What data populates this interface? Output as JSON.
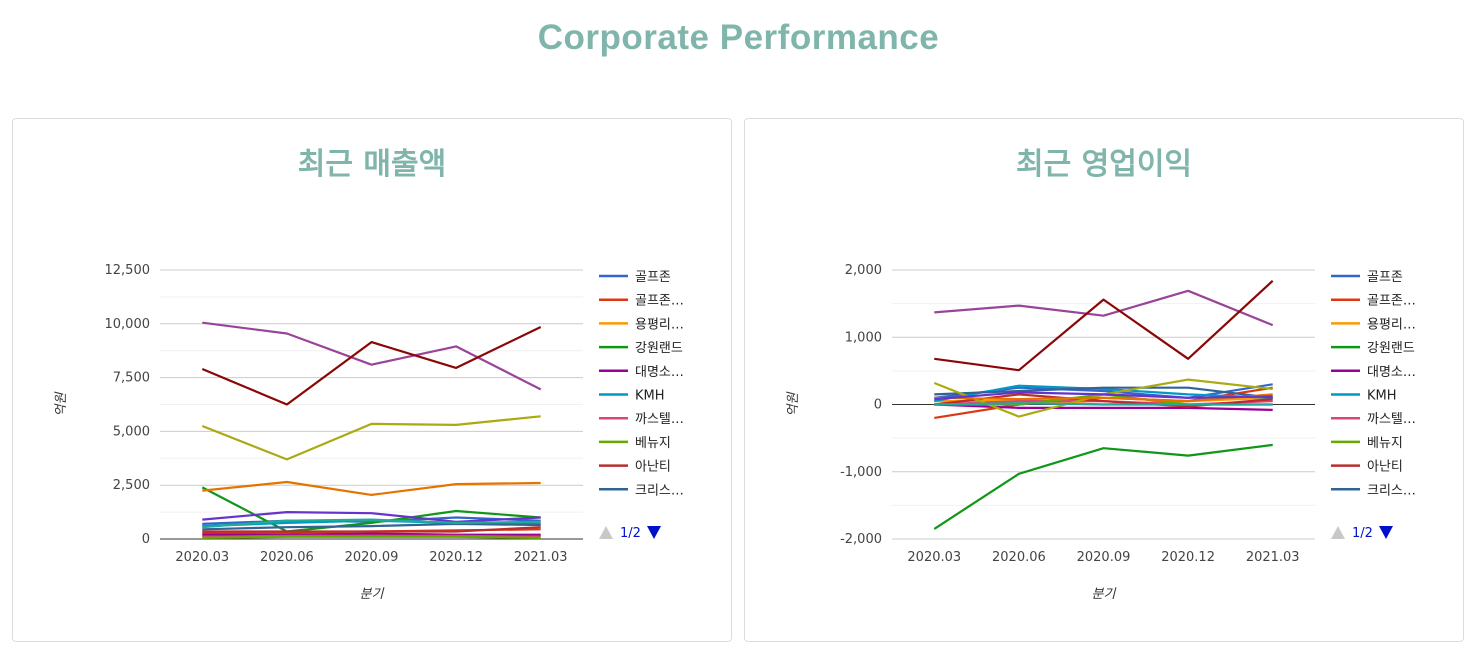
{
  "page": {
    "title": "Corporate Performance"
  },
  "colors": {
    "title": "#7fb5ab",
    "series": [
      "#3366cc",
      "#dc3912",
      "#ff9900",
      "#109618",
      "#990099",
      "#0099c6",
      "#dd4477",
      "#66aa00",
      "#b82e2e",
      "#316395"
    ],
    "extra_series": [
      "#994499",
      "#8b0707",
      "#aaaa11",
      "#e67300",
      "#6633cc",
      "#22aa99"
    ]
  },
  "legend": {
    "items": [
      "골프존",
      "골프존…",
      "용평리…",
      "강원랜드",
      "대명소…",
      "KMH",
      "까스텔…",
      "베뉴지",
      "아난티",
      "크리스…"
    ],
    "pager": "1/2"
  },
  "chart_data": [
    {
      "type": "line",
      "title": "최근 매출액",
      "xlabel": "분기",
      "ylabel": "억원",
      "x": [
        "2020.03",
        "2020.06",
        "2020.09",
        "2020.12",
        "2021.03"
      ],
      "ylim": [
        0,
        12500
      ],
      "yticks": [
        0,
        2500,
        5000,
        7500,
        10000,
        12500
      ],
      "ytick_labels": [
        "0",
        "2,500",
        "5,000",
        "7,500",
        "10,000",
        "12,500"
      ],
      "series": [
        {
          "name": "골프존",
          "values": [
            700,
            850,
            800,
            1000,
            850
          ]
        },
        {
          "name": "골프존…",
          "values": [
            250,
            300,
            350,
            400,
            450
          ]
        },
        {
          "name": "용평리…",
          "values": [
            150,
            200,
            250,
            200,
            150
          ]
        },
        {
          "name": "강원랜드",
          "values": [
            2400,
            350,
            750,
            1300,
            1000
          ]
        },
        {
          "name": "대명소…",
          "values": [
            200,
            200,
            250,
            200,
            200
          ]
        },
        {
          "name": "KMH",
          "values": [
            600,
            750,
            850,
            750,
            700
          ]
        },
        {
          "name": "까스텔…",
          "values": [
            100,
            150,
            150,
            150,
            100
          ]
        },
        {
          "name": "베뉴지",
          "values": [
            50,
            100,
            100,
            100,
            50
          ]
        },
        {
          "name": "아난티",
          "values": [
            350,
            350,
            350,
            350,
            550
          ]
        },
        {
          "name": "크리스…",
          "values": [
            450,
            550,
            600,
            700,
            650
          ]
        },
        {
          "values": [
            10050,
            9550,
            8100,
            8950,
            6950
          ]
        },
        {
          "values": [
            7900,
            6250,
            9150,
            7950,
            9850
          ]
        },
        {
          "values": [
            5250,
            3700,
            5350,
            5300,
            5700
          ]
        },
        {
          "values": [
            2250,
            2650,
            2050,
            2550,
            2600
          ]
        },
        {
          "values": [
            900,
            1250,
            1200,
            800,
            1000
          ]
        },
        {
          "values": [
            550,
            850,
            900,
            750,
            800
          ]
        }
      ]
    },
    {
      "type": "line",
      "title": "최근 영업이익",
      "xlabel": "분기",
      "ylabel": "억원",
      "x": [
        "2020.03",
        "2020.06",
        "2020.09",
        "2020.12",
        "2021.03"
      ],
      "ylim": [
        -2000,
        2000
      ],
      "yticks": [
        -2000,
        -1000,
        0,
        1000,
        2000
      ],
      "ytick_labels": [
        "-2,000",
        "-1,000",
        "0",
        "1,000",
        "2,000"
      ],
      "series": [
        {
          "name": "골프존",
          "values": [
            100,
            250,
            200,
            100,
            300
          ]
        },
        {
          "name": "골프존…",
          "values": [
            -200,
            0,
            100,
            50,
            250
          ]
        },
        {
          "name": "용평리…",
          "values": [
            50,
            50,
            0,
            50,
            100
          ]
        },
        {
          "name": "강원랜드",
          "values": [
            -1850,
            -1030,
            -650,
            -760,
            -600
          ]
        },
        {
          "name": "대명소…",
          "values": [
            0,
            -50,
            -50,
            -50,
            -80
          ]
        },
        {
          "name": "KMH",
          "values": [
            50,
            280,
            230,
            150,
            100
          ]
        },
        {
          "name": "까스텔…",
          "values": [
            0,
            50,
            50,
            0,
            50
          ]
        },
        {
          "name": "베뉴지",
          "values": [
            0,
            0,
            150,
            0,
            0
          ]
        },
        {
          "name": "아난티",
          "values": [
            0,
            150,
            50,
            -30,
            80
          ]
        },
        {
          "name": "크리스…",
          "values": [
            150,
            200,
            250,
            250,
            100
          ]
        },
        {
          "values": [
            1370,
            1470,
            1320,
            1690,
            1180
          ]
        },
        {
          "values": [
            680,
            510,
            1560,
            680,
            1840
          ]
        },
        {
          "values": [
            320,
            -180,
            150,
            370,
            230
          ]
        },
        {
          "values": [
            100,
            80,
            100,
            50,
            150
          ]
        },
        {
          "values": [
            80,
            180,
            150,
            100,
            120
          ]
        },
        {
          "values": [
            0,
            20,
            0,
            0,
            0
          ]
        }
      ]
    }
  ]
}
